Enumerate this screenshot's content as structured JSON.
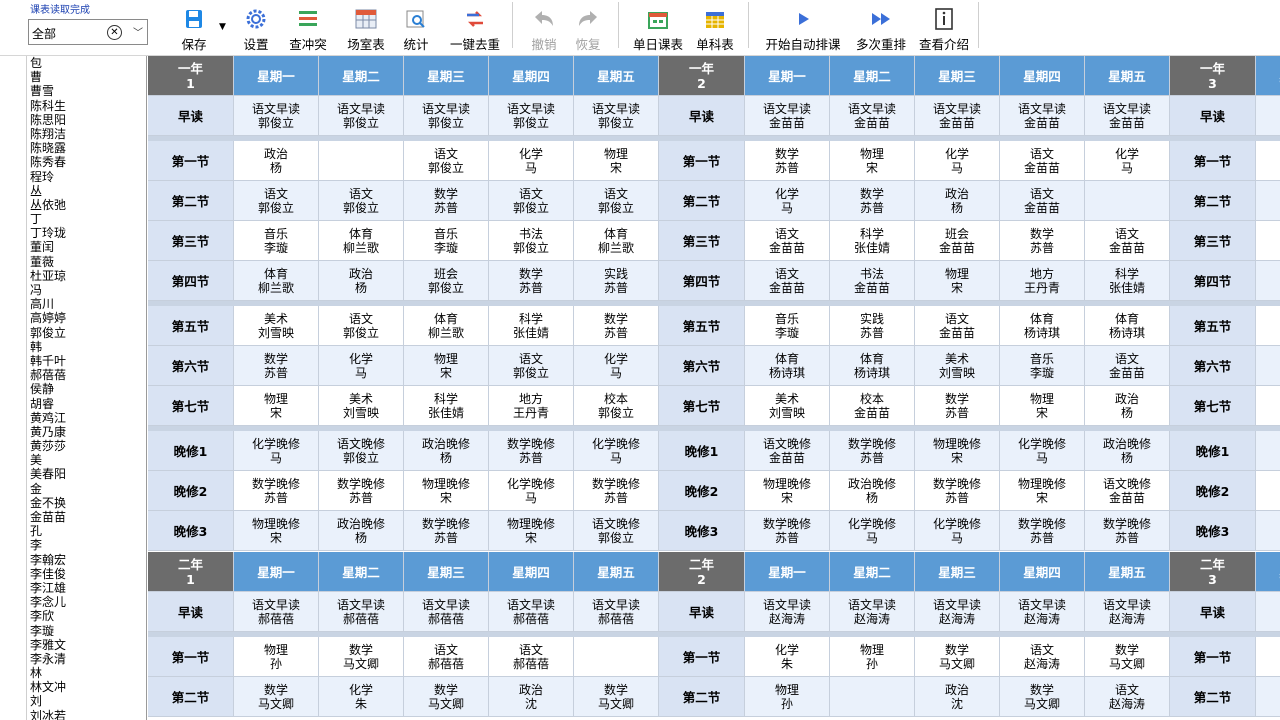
{
  "status_text": "课表读取完成",
  "filter": {
    "value": "全部",
    "clear_icon": "clear-circle-icon",
    "dropdown_icon": "chevron-down-icon"
  },
  "toolbar": [
    {
      "label": "保存",
      "icon": "save-icon",
      "color": "#1e88e5",
      "disabled": false
    },
    {
      "label": "设置",
      "icon": "gear-icon",
      "color": "#3b6fd8",
      "disabled": false
    },
    {
      "label": "查冲突",
      "icon": "conflict-icon",
      "color": "#e05a3a",
      "disabled": false
    },
    {
      "label": "场室表",
      "icon": "room-table-icon",
      "color": "#7b8aa6",
      "disabled": false
    },
    {
      "label": "统计",
      "icon": "statistics-icon",
      "color": "#2a7fd4",
      "disabled": false
    },
    {
      "label": "一键去重",
      "icon": "dedupe-icon",
      "color": "#e04a3a",
      "disabled": false
    },
    {
      "label": "撤销",
      "icon": "undo-icon",
      "color": "#b0b0b0",
      "disabled": true
    },
    {
      "label": "恢复",
      "icon": "redo-icon",
      "color": "#b0b0b0",
      "disabled": true
    },
    {
      "label": "单日课表",
      "icon": "daily-schedule-icon",
      "color": "#3aa55a",
      "disabled": false
    },
    {
      "label": "单科表",
      "icon": "subject-schedule-icon",
      "color": "#e6b400",
      "disabled": false
    },
    {
      "label": "开始自动排课",
      "icon": "play-icon",
      "color": "#3b6fd8",
      "disabled": false
    },
    {
      "label": "多次重排",
      "icon": "fast-forward-icon",
      "color": "#3b6fd8",
      "disabled": false
    },
    {
      "label": "查看介绍",
      "icon": "info-icon",
      "color": "#333333",
      "disabled": false
    }
  ],
  "names": [
    "包",
    "曹",
    "曹雪",
    "陈科生",
    "陈思阳",
    "陈翔洁",
    "陈晓露",
    "陈秀春",
    "程玲",
    "丛",
    "丛依弛",
    "丁",
    "丁玲珑",
    "董闰",
    "董薇",
    "杜亚琼",
    "冯",
    "高川",
    "高婷婷",
    "郭俊立",
    "韩",
    "韩千叶",
    "郝蓓蓓",
    "侯静",
    "胡睿",
    "黄鸡江",
    "黄乃康",
    "黄莎莎",
    "美",
    "美春阳",
    "金",
    "金不换",
    "金苗苗",
    "孔",
    "李",
    "李翰宏",
    "李佳俊",
    "李江雄",
    "李念儿",
    "李欣",
    "李璇",
    "李雅文",
    "李永清",
    "林",
    "林文冲",
    "刘",
    "刘冰若"
  ],
  "days": [
    "星期一",
    "星期二",
    "星期三",
    "星期四",
    "星期五"
  ],
  "period_labels": [
    "早读",
    "第一节",
    "第二节",
    "第三节",
    "第四节",
    "第五节",
    "第六节",
    "第七节",
    "晚修1",
    "晚修2",
    "晚修3"
  ],
  "blocks": [
    {
      "classes": [
        {
          "label": [
            "一年",
            "1"
          ],
          "rows": [
            [
              [
                "语文早读",
                "郭俊立"
              ],
              [
                "语文早读",
                "郭俊立"
              ],
              [
                "语文早读",
                "郭俊立"
              ],
              [
                "语文早读",
                "郭俊立"
              ],
              [
                "语文早读",
                "郭俊立"
              ]
            ],
            [
              [
                "政治",
                "杨"
              ],
              [
                "",
                ""
              ],
              [
                "语文",
                "郭俊立"
              ],
              [
                "化学",
                "马"
              ],
              [
                "物理",
                "宋"
              ]
            ],
            [
              [
                "语文",
                "郭俊立"
              ],
              [
                "语文",
                "郭俊立"
              ],
              [
                "数学",
                "苏普"
              ],
              [
                "语文",
                "郭俊立"
              ],
              [
                "语文",
                "郭俊立"
              ]
            ],
            [
              [
                "音乐",
                "李璇"
              ],
              [
                "体育",
                "柳兰歌"
              ],
              [
                "音乐",
                "李璇"
              ],
              [
                "书法",
                "郭俊立"
              ],
              [
                "体育",
                "柳兰歌"
              ]
            ],
            [
              [
                "体育",
                "柳兰歌"
              ],
              [
                "政治",
                "杨"
              ],
              [
                "班会",
                "郭俊立"
              ],
              [
                "数学",
                "苏普"
              ],
              [
                "实践",
                "苏普"
              ]
            ],
            [
              [
                "美术",
                "刘雪映"
              ],
              [
                "语文",
                "郭俊立"
              ],
              [
                "体育",
                "柳兰歌"
              ],
              [
                "科学",
                "张佳婧"
              ],
              [
                "数学",
                "苏普"
              ]
            ],
            [
              [
                "数学",
                "苏普"
              ],
              [
                "化学",
                "马"
              ],
              [
                "物理",
                "宋"
              ],
              [
                "语文",
                "郭俊立"
              ],
              [
                "化学",
                "马"
              ]
            ],
            [
              [
                "物理",
                "宋"
              ],
              [
                "美术",
                "刘雪映"
              ],
              [
                "科学",
                "张佳婧"
              ],
              [
                "地方",
                "王丹青"
              ],
              [
                "校本",
                "郭俊立"
              ]
            ],
            [
              [
                "化学晚修",
                "马"
              ],
              [
                "语文晚修",
                "郭俊立"
              ],
              [
                "政治晚修",
                "杨"
              ],
              [
                "数学晚修",
                "苏普"
              ],
              [
                "化学晚修",
                "马"
              ]
            ],
            [
              [
                "数学晚修",
                "苏普"
              ],
              [
                "数学晚修",
                "苏普"
              ],
              [
                "物理晚修",
                "宋"
              ],
              [
                "化学晚修",
                "马"
              ],
              [
                "数学晚修",
                "苏普"
              ]
            ],
            [
              [
                "物理晚修",
                "宋"
              ],
              [
                "政治晚修",
                "杨"
              ],
              [
                "数学晚修",
                "苏普"
              ],
              [
                "物理晚修",
                "宋"
              ],
              [
                "语文晚修",
                "郭俊立"
              ]
            ]
          ]
        },
        {
          "label": [
            "一年",
            "2"
          ],
          "rows": [
            [
              [
                "语文早读",
                "金苗苗"
              ],
              [
                "语文早读",
                "金苗苗"
              ],
              [
                "语文早读",
                "金苗苗"
              ],
              [
                "语文早读",
                "金苗苗"
              ],
              [
                "语文早读",
                "金苗苗"
              ]
            ],
            [
              [
                "数学",
                "苏普"
              ],
              [
                "物理",
                "宋"
              ],
              [
                "化学",
                "马"
              ],
              [
                "语文",
                "金苗苗"
              ],
              [
                "化学",
                "马"
              ]
            ],
            [
              [
                "化学",
                "马"
              ],
              [
                "数学",
                "苏普"
              ],
              [
                "政治",
                "杨"
              ],
              [
                "语文",
                "金苗苗"
              ],
              [
                "",
                ""
              ]
            ],
            [
              [
                "语文",
                "金苗苗"
              ],
              [
                "科学",
                "张佳婧"
              ],
              [
                "班会",
                "金苗苗"
              ],
              [
                "数学",
                "苏普"
              ],
              [
                "语文",
                "金苗苗"
              ]
            ],
            [
              [
                "语文",
                "金苗苗"
              ],
              [
                "书法",
                "金苗苗"
              ],
              [
                "物理",
                "宋"
              ],
              [
                "地方",
                "王丹青"
              ],
              [
                "科学",
                "张佳婧"
              ]
            ],
            [
              [
                "音乐",
                "李璇"
              ],
              [
                "实践",
                "苏普"
              ],
              [
                "语文",
                "金苗苗"
              ],
              [
                "体育",
                "杨诗琪"
              ],
              [
                "体育",
                "杨诗琪"
              ]
            ],
            [
              [
                "体育",
                "杨诗琪"
              ],
              [
                "体育",
                "杨诗琪"
              ],
              [
                "美术",
                "刘雪映"
              ],
              [
                "音乐",
                "李璇"
              ],
              [
                "语文",
                "金苗苗"
              ]
            ],
            [
              [
                "美术",
                "刘雪映"
              ],
              [
                "校本",
                "金苗苗"
              ],
              [
                "数学",
                "苏普"
              ],
              [
                "物理",
                "宋"
              ],
              [
                "政治",
                "杨"
              ]
            ],
            [
              [
                "语文晚修",
                "金苗苗"
              ],
              [
                "数学晚修",
                "苏普"
              ],
              [
                "物理晚修",
                "宋"
              ],
              [
                "化学晚修",
                "马"
              ],
              [
                "政治晚修",
                "杨"
              ]
            ],
            [
              [
                "物理晚修",
                "宋"
              ],
              [
                "政治晚修",
                "杨"
              ],
              [
                "数学晚修",
                "苏普"
              ],
              [
                "物理晚修",
                "宋"
              ],
              [
                "语文晚修",
                "金苗苗"
              ]
            ],
            [
              [
                "数学晚修",
                "苏普"
              ],
              [
                "化学晚修",
                "马"
              ],
              [
                "化学晚修",
                "马"
              ],
              [
                "数学晚修",
                "苏普"
              ],
              [
                "数学晚修",
                "苏普"
              ]
            ]
          ]
        },
        {
          "label": [
            "一年",
            "3"
          ],
          "rows": [
            [
              [
                "语",
                ""
              ]
            ],
            [
              [
                "",
                ""
              ]
            ],
            [
              [
                "",
                ""
              ]
            ],
            [
              [
                "",
                ""
              ]
            ],
            [
              [
                "",
                ""
              ]
            ],
            [
              [
                "",
                ""
              ]
            ],
            [
              [
                "",
                ""
              ]
            ],
            [
              [
                "",
                ""
              ]
            ],
            [
              [
                "物",
                ""
              ]
            ],
            [
              [
                "化",
                ""
              ]
            ],
            [
              [
                "化",
                ""
              ]
            ]
          ]
        }
      ]
    },
    {
      "classes": [
        {
          "label": [
            "二年",
            "1"
          ],
          "rows": [
            [
              [
                "语文早读",
                "郝蓓蓓"
              ],
              [
                "语文早读",
                "郝蓓蓓"
              ],
              [
                "语文早读",
                "郝蓓蓓"
              ],
              [
                "语文早读",
                "郝蓓蓓"
              ],
              [
                "语文早读",
                "郝蓓蓓"
              ]
            ],
            [
              [
                "物理",
                "孙"
              ],
              [
                "数学",
                "马文卿"
              ],
              [
                "语文",
                "郝蓓蓓"
              ],
              [
                "语文",
                "郝蓓蓓"
              ],
              [
                "",
                ""
              ]
            ],
            [
              [
                "数学",
                "马文卿"
              ],
              [
                "化学",
                "朱"
              ],
              [
                "数学",
                "马文卿"
              ],
              [
                "政治",
                "沈"
              ],
              [
                "数学",
                "马文卿"
              ]
            ]
          ]
        },
        {
          "label": [
            "二年",
            "2"
          ],
          "rows": [
            [
              [
                "语文早读",
                "赵海涛"
              ],
              [
                "语文早读",
                "赵海涛"
              ],
              [
                "语文早读",
                "赵海涛"
              ],
              [
                "语文早读",
                "赵海涛"
              ],
              [
                "语文早读",
                "赵海涛"
              ]
            ],
            [
              [
                "化学",
                "朱"
              ],
              [
                "物理",
                "孙"
              ],
              [
                "数学",
                "马文卿"
              ],
              [
                "语文",
                "赵海涛"
              ],
              [
                "数学",
                "马文卿"
              ]
            ],
            [
              [
                "物理",
                "孙"
              ],
              [
                "",
                ""
              ],
              [
                "政治",
                "沈"
              ],
              [
                "数学",
                "马文卿"
              ],
              [
                "语文",
                "赵海涛"
              ]
            ]
          ]
        },
        {
          "label": [
            "二年",
            "3"
          ],
          "rows": [
            [
              [
                "语",
                ""
              ]
            ],
            [
              [
                "",
                ""
              ]
            ],
            [
              [
                "",
                ""
              ]
            ]
          ]
        }
      ]
    }
  ]
}
